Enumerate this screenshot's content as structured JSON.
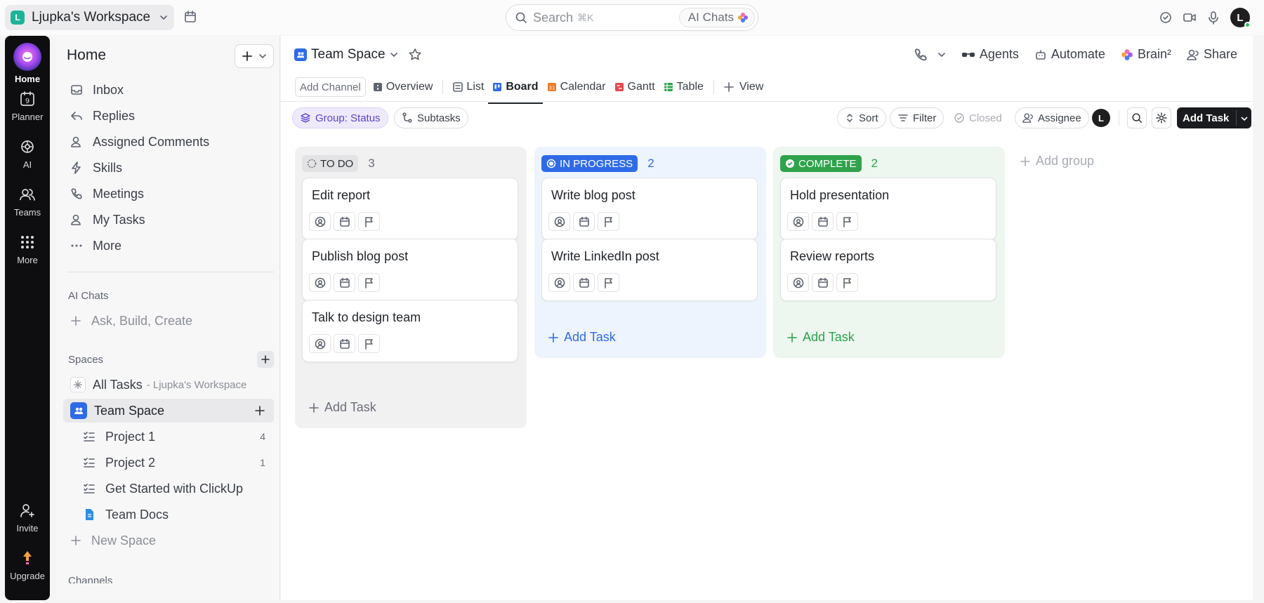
{
  "workspace": {
    "badge": "L",
    "name": "Ljupka's Workspace"
  },
  "search": {
    "placeholder": "Search",
    "shortcut": "⌘K",
    "ai_label": "AI Chats"
  },
  "user": {
    "initial": "L"
  },
  "rail": {
    "items": [
      {
        "label": "Home"
      },
      {
        "label": "Planner",
        "calendar_day": "9"
      },
      {
        "label": "AI"
      },
      {
        "label": "Teams"
      },
      {
        "label": "More"
      }
    ],
    "bottom": [
      {
        "label": "Invite"
      },
      {
        "label": "Upgrade"
      }
    ]
  },
  "sidebar": {
    "title": "Home",
    "nav": [
      {
        "label": "Inbox"
      },
      {
        "label": "Replies"
      },
      {
        "label": "Assigned Comments"
      },
      {
        "label": "Skills"
      },
      {
        "label": "Meetings"
      },
      {
        "label": "My Tasks"
      },
      {
        "label": "More"
      }
    ],
    "ai_chats": {
      "title": "AI Chats",
      "action": "Ask, Build, Create"
    },
    "spaces": {
      "title": "Spaces",
      "all_tasks": {
        "label": "All Tasks",
        "sub": "- Ljupka's Workspace"
      },
      "team_space": "Team Space",
      "lists": [
        {
          "label": "Project 1",
          "count": "4"
        },
        {
          "label": "Project 2",
          "count": "1"
        },
        {
          "label": "Get Started with ClickUp",
          "count": ""
        },
        {
          "label": "Team Docs",
          "count": ""
        }
      ],
      "new_space": "New Space"
    },
    "channels_title": "Channels"
  },
  "header": {
    "space_name": "Team Space",
    "actions": {
      "agents": "Agents",
      "automate": "Automate",
      "brain": "Brain²",
      "share": "Share"
    }
  },
  "views": {
    "add_channel": "Add Channel",
    "tabs": [
      {
        "label": "Overview"
      },
      {
        "label": "List"
      },
      {
        "label": "Board"
      },
      {
        "label": "Calendar",
        "icon_text": "31"
      },
      {
        "label": "Gantt"
      },
      {
        "label": "Table"
      }
    ],
    "add_view": "View"
  },
  "toolbar": {
    "group": "Group: Status",
    "subtasks": "Subtasks",
    "sort": "Sort",
    "filter": "Filter",
    "closed": "Closed",
    "assignee": "Assignee",
    "assignee_initial": "L",
    "add_task": "Add Task"
  },
  "board": {
    "columns": [
      {
        "status": "TO DO",
        "count": "3",
        "tasks": [
          "Edit report",
          "Publish blog post",
          "Talk to design team"
        ],
        "add": "Add Task"
      },
      {
        "status": "IN PROGRESS",
        "count": "2",
        "tasks": [
          "Write blog post",
          "Write LinkedIn post"
        ],
        "add": "Add Task"
      },
      {
        "status": "COMPLETE",
        "count": "2",
        "tasks": [
          "Hold presentation",
          "Review reports"
        ],
        "add": "Add Task"
      }
    ],
    "add_group": "Add group"
  },
  "colors": {
    "accent": "#2f6be6",
    "complete": "#2fa24c",
    "todo_bg": "#f1f1f2",
    "progress_bg": "#eef4fd",
    "complete_bg": "#edf6ef"
  }
}
